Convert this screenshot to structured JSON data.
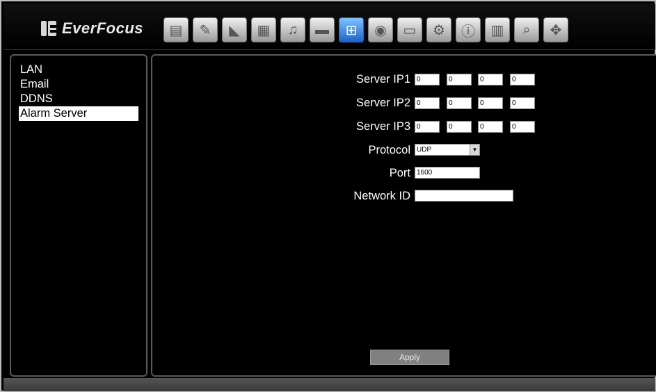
{
  "brand": {
    "name": "EverFocus"
  },
  "toolbar": {
    "icons": [
      {
        "name": "monitor-icon",
        "glyph": "▤"
      },
      {
        "name": "tools-icon",
        "glyph": "✎"
      },
      {
        "name": "camera-icon",
        "glyph": "◣"
      },
      {
        "name": "film-icon",
        "glyph": "▦"
      },
      {
        "name": "alarm-bell-icon",
        "glyph": "♫"
      },
      {
        "name": "disk-icon",
        "glyph": "▬"
      },
      {
        "name": "network-icon",
        "glyph": "⊞"
      },
      {
        "name": "record-icon",
        "glyph": "◉"
      },
      {
        "name": "display-icon",
        "glyph": "▭"
      },
      {
        "name": "gear-icon",
        "glyph": "⚙"
      },
      {
        "name": "info-icon",
        "glyph": "ⓘ"
      },
      {
        "name": "log-icon",
        "glyph": "▥"
      },
      {
        "name": "search-icon",
        "glyph": "⌕"
      },
      {
        "name": "ptz-icon",
        "glyph": "✥"
      }
    ],
    "active_index": 6,
    "active_color": "#1e63c8"
  },
  "sidebar": {
    "items": [
      {
        "label": "LAN"
      },
      {
        "label": "Email"
      },
      {
        "label": "DDNS"
      },
      {
        "label": "Alarm Server",
        "selected": true
      }
    ]
  },
  "form": {
    "server_ip1": {
      "label": "Server IP1",
      "octets": [
        "0",
        "0",
        "0",
        "0"
      ]
    },
    "server_ip2": {
      "label": "Server IP2",
      "octets": [
        "0",
        "0",
        "0",
        "0"
      ]
    },
    "server_ip3": {
      "label": "Server IP3",
      "octets": [
        "0",
        "0",
        "0",
        "0"
      ]
    },
    "protocol": {
      "label": "Protocol",
      "value": "UDP"
    },
    "port": {
      "label": "Port",
      "value": "1600"
    },
    "network_id": {
      "label": "Network ID",
      "value": ""
    },
    "apply_label": "Apply"
  }
}
